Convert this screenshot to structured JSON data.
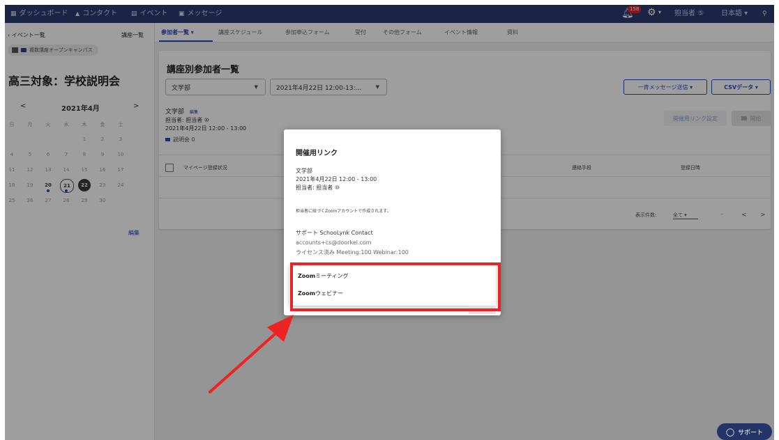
{
  "topnav": {
    "items": [
      {
        "icon": "dashboard-icon",
        "glyph": "▦",
        "label": "ダッシュボード"
      },
      {
        "icon": "contact-icon",
        "glyph": "👤",
        "label": "コンタクト"
      },
      {
        "icon": "event-icon",
        "glyph": "▤",
        "label": "イベント"
      },
      {
        "icon": "message-icon",
        "glyph": "▣",
        "label": "メッセージ"
      }
    ],
    "notification_count": "158",
    "user": "担当者 ⑤",
    "language": "日本語 ▾"
  },
  "sidebar": {
    "back_label": "‹ イベント一覧",
    "course_list_label": "講座一覧",
    "tag_label": "複数講座オープンキャンパス",
    "event_title": "高三対象：学校説明会",
    "calendar": {
      "prev": "<",
      "month": "2021年4月",
      "next": ">",
      "dow": [
        "日",
        "月",
        "火",
        "水",
        "木",
        "金",
        "土"
      ],
      "weeks": [
        [
          "",
          "",
          "",
          "",
          "1",
          "2",
          "3"
        ],
        [
          "4",
          "5",
          "6",
          "7",
          "8",
          "9",
          "10"
        ],
        [
          "11",
          "12",
          "13",
          "14",
          "15",
          "16",
          "17"
        ],
        [
          "18",
          "19",
          "20",
          "21",
          "22",
          "23",
          "24"
        ],
        [
          "25",
          "26",
          "27",
          "28",
          "29",
          "30",
          ""
        ]
      ]
    },
    "edit_label": "編集"
  },
  "tabs": [
    {
      "label": "参加者一覧 ▾",
      "active": true
    },
    {
      "label": "講座スケジュール",
      "active": false
    },
    {
      "label": "参加申込フォーム",
      "active": false
    },
    {
      "label": "受付",
      "active": false
    },
    {
      "label": "その他フォーム",
      "active": false
    },
    {
      "label": "イベント情報",
      "active": false
    },
    {
      "label": "資料",
      "active": false
    }
  ],
  "main": {
    "title": "講座別参加者一覧",
    "faculty_select": "文学部",
    "date_select": "2021年4月22日 12:00-13:...",
    "bulk_message_button": "一斉メッセージ送信 ▾",
    "csv_button": "CSVデータ ▾",
    "info_name": "文学部",
    "info_edit": "編集",
    "info_owner": "担当者: 担当者 ⑩",
    "info_datetime": "2021年4月22日 12:00 - 13:00",
    "info_session": "説明会 0",
    "link_settings_button": "開催用リンク設定",
    "start_button": "開始",
    "columns": {
      "status": "マイページ登録状況",
      "contact": "連絡手段",
      "registered": "登録日時"
    },
    "pager": {
      "per_page_label": "表示件数:",
      "per_page_value": "全て ▾",
      "range": "-",
      "prev": "<",
      "next": ">"
    }
  },
  "modal": {
    "title": "開催用リンク",
    "faculty": "文学部",
    "datetime": "2021年4月22日 12:00 - 13:00",
    "owner": "担当者: 担当者 ⑩",
    "note": "担当者に紐づくZoomアカウントで作成されます。",
    "support_name": "サポート SchooLynk Contact",
    "support_email": "accounts+cs@doorkel.com",
    "license": "ライセンス済み Meeting:100 Webinar:100",
    "options": [
      {
        "bold": "Zoom",
        "rest": "ミーティング"
      },
      {
        "bold": "Zoom",
        "rest": "ウェビナー"
      }
    ]
  },
  "support_button": "サポート",
  "colors": {
    "nav": "#2d3b70",
    "accent": "#2a46c0",
    "highlight": "#ee2222"
  }
}
